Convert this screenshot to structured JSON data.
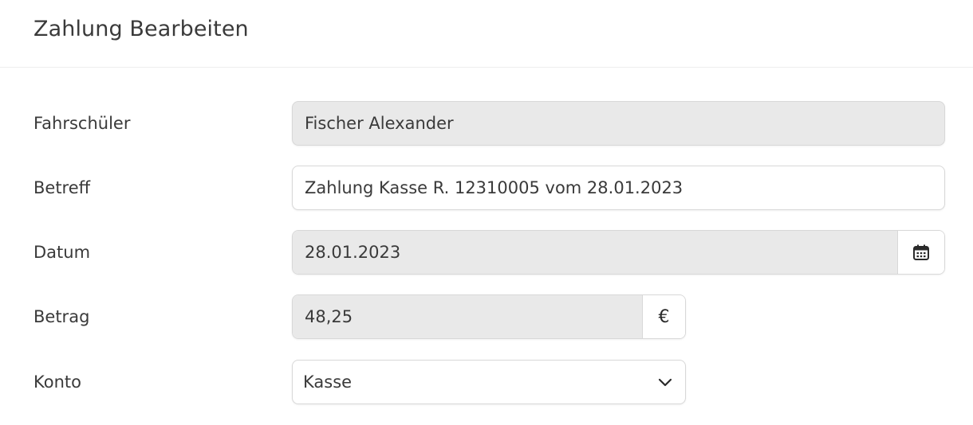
{
  "header": {
    "title": "Zahlung Bearbeiten"
  },
  "form": {
    "student": {
      "label": "Fahrschüler",
      "value": "Fischer Alexander"
    },
    "subject": {
      "label": "Betreff",
      "value": "Zahlung Kasse R. 12310005 vom 28.01.2023"
    },
    "date": {
      "label": "Datum",
      "value": "28.01.2023",
      "addon_icon": "calendar-icon"
    },
    "amount": {
      "label": "Betrag",
      "value": "48,25",
      "currency": "€"
    },
    "account": {
      "label": "Konto",
      "value": "Kasse",
      "dropdown_icon": "chevron-down-icon"
    }
  }
}
